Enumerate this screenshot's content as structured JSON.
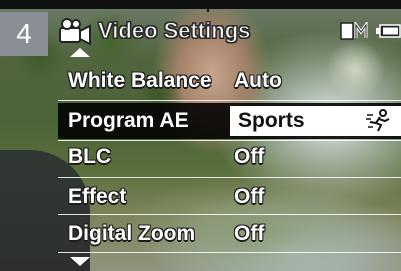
{
  "step_number": "4",
  "menu": {
    "title": "Video Settings",
    "title_icon": "video-camera-icon",
    "status_icons": [
      "memory-mode-icon",
      "battery-icon"
    ],
    "items": [
      {
        "label": "White Balance",
        "value": "Auto",
        "selected": false
      },
      {
        "label": "Program AE",
        "value": "Sports",
        "selected": true,
        "value_icon": "sports-running-icon"
      },
      {
        "label": "BLC",
        "value": "Off",
        "selected": false
      },
      {
        "label": "Effect",
        "value": "Off",
        "selected": false
      },
      {
        "label": "Digital Zoom",
        "value": "Off",
        "selected": false
      }
    ]
  },
  "colors": {
    "badge_bg": "#8a8f96",
    "highlight_bg": "#000000",
    "selected_value_bg": "#ffffff",
    "text": "#ffffff"
  }
}
